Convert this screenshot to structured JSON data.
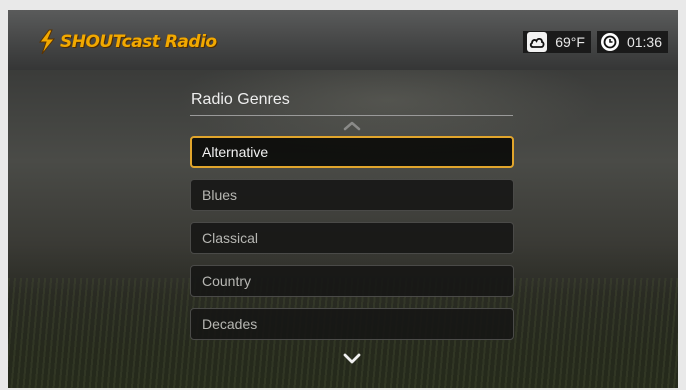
{
  "header": {
    "app_logo_text": "SHOUTcast Radio",
    "weather": {
      "icon": "cloud-icon",
      "temperature": "69°F"
    },
    "clock": {
      "icon": "clock-icon",
      "time": "01:36"
    }
  },
  "panel": {
    "title": "Radio Genres",
    "scroll_up_icon": "chevron-up-icon",
    "scroll_down_icon": "chevron-down-icon",
    "items": [
      {
        "label": "Alternative",
        "selected": true
      },
      {
        "label": "Blues",
        "selected": false
      },
      {
        "label": "Classical",
        "selected": false
      },
      {
        "label": "Country",
        "selected": false
      },
      {
        "label": "Decades",
        "selected": false
      }
    ]
  },
  "colors": {
    "selection_border": "#e1a52c",
    "logo": "#f2a900"
  }
}
